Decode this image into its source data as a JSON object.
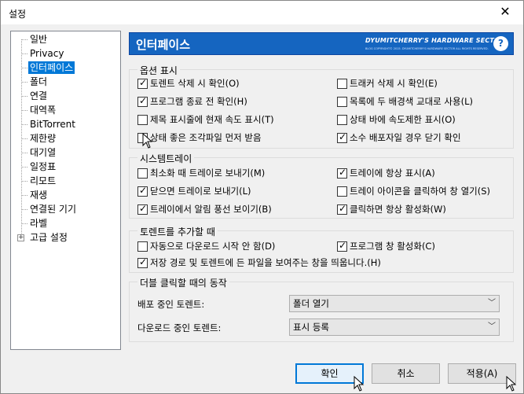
{
  "window": {
    "title": "설정",
    "close_glyph": "✕"
  },
  "tree": {
    "items": [
      {
        "label": "일반"
      },
      {
        "label": "Privacy"
      },
      {
        "label": "인터페이스",
        "selected": true
      },
      {
        "label": "폴더"
      },
      {
        "label": "연결"
      },
      {
        "label": "대역폭"
      },
      {
        "label": "BitTorrent"
      },
      {
        "label": "제한량"
      },
      {
        "label": "대기열"
      },
      {
        "label": "일정표"
      },
      {
        "label": "리모트"
      },
      {
        "label": "재생"
      },
      {
        "label": "연결된 기기"
      },
      {
        "label": "라벨"
      },
      {
        "label": "고급 설정",
        "expandable": true,
        "expander_glyph": "+"
      }
    ]
  },
  "banner": {
    "title": "인터페이스",
    "brand": "DYUMITCHERRY'S HARDWARE SECTOR",
    "copyright": "BLOG COPYRIGHT© 2015. DYUMITCHERRY'S HARDWARE SECTOR ALL RIGHTS RESERVED.",
    "help_glyph": "?",
    "color": "#1565c0"
  },
  "groups": {
    "display": {
      "title": "옵션 표시",
      "options": [
        {
          "label": "토렌트 삭제 시 확인(O)",
          "checked": true
        },
        {
          "label": "트래커 삭제 시 확인(E)",
          "checked": false
        },
        {
          "label": "프로그램 종료 전 확인(H)",
          "checked": true
        },
        {
          "label": "목록에 두 배경색 교대로 사용(L)",
          "checked": false
        },
        {
          "label": "제목 표시줄에 현재 속도 표시(T)",
          "checked": false
        },
        {
          "label": "상태 바에 속도제한 표시(O)",
          "checked": false
        },
        {
          "label": "상태 좋은 조각파일 먼저 받음",
          "checked": false
        },
        {
          "label": "소수 배포자일 경우 닫기 확인",
          "checked": true
        }
      ]
    },
    "tray": {
      "title": "시스템트레이",
      "options": [
        {
          "label": "최소화 때 트레이로 보내기(M)",
          "checked": false
        },
        {
          "label": "트레이에 항상 표시(A)",
          "checked": true
        },
        {
          "label": "닫으면 트레이로 보내기(L)",
          "checked": true
        },
        {
          "label": "트레이 아이콘을 클릭하여 창 열기(S)",
          "checked": false
        },
        {
          "label": "트레이에서 알림 풍선 보이기(B)",
          "checked": true
        },
        {
          "label": "클릭하면 항상 활성화(W)",
          "checked": true
        }
      ]
    },
    "add": {
      "title": "토렌트를 추가할 때",
      "options": [
        {
          "label": "자동으로 다운로드 시작 안 함(D)",
          "checked": false
        },
        {
          "label": "프로그램 창 활성화(C)",
          "checked": true
        },
        {
          "label": "저장 경로 및 토렌트에 든 파일을 보여주는 창을 띄웁니다.(H)",
          "checked": true
        }
      ]
    },
    "dblclick": {
      "title": "더블 클릭할 때의 동작",
      "rows": [
        {
          "label": "배포 중인 토렌트:",
          "value": "폴더 열기"
        },
        {
          "label": "다운로드 중인 토렌트:",
          "value": "표시 등록"
        }
      ],
      "arrow_glyph": "﹀"
    }
  },
  "buttons": {
    "ok": "확인",
    "cancel": "취소",
    "apply": "적용(A)"
  }
}
